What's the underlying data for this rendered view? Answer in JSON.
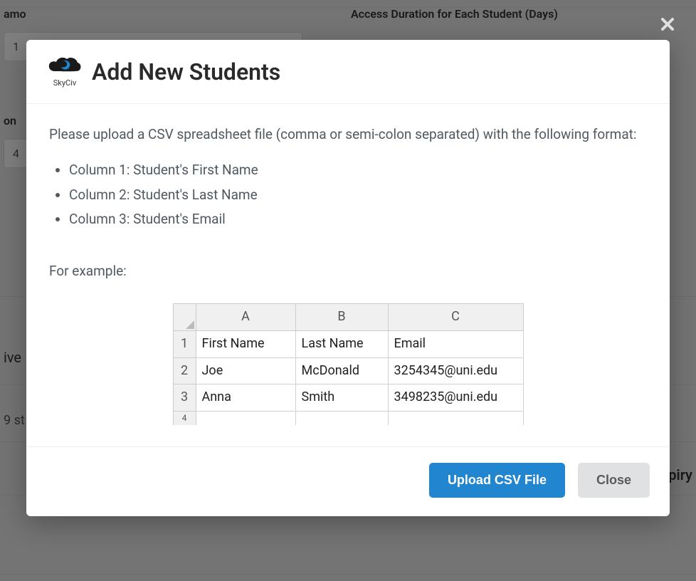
{
  "background": {
    "name_label_partial": "amo",
    "name_value_partial": " 1",
    "phone_label_partial": "on",
    "phone_value_partial": "4",
    "access_label": "Access Duration for Each Student (Days)",
    "section_partial": "ive",
    "count_partial": "9 st",
    "expiry_label": "xpiry"
  },
  "modal": {
    "logo_text": "SkyCiv",
    "title": "Add New Students",
    "instruction": "Please upload a CSV spreadsheet file (comma or semi-colon separated) with the following format:",
    "columns": [
      "Column 1: Student's First Name",
      "Column 2: Student's Last Name",
      "Column 3: Student's Email"
    ],
    "example_label": "For example:",
    "example_table": {
      "col_headers": [
        "A",
        "B",
        "C"
      ],
      "row_headers": [
        "1",
        "2",
        "3",
        "4"
      ],
      "rows": [
        [
          "First Name",
          "Last Name",
          "Email"
        ],
        [
          "Joe",
          "McDonald",
          "3254345@uni.edu"
        ],
        [
          "Anna",
          "Smith",
          "3498235@uni.edu"
        ]
      ]
    },
    "upload_button": "Upload CSV File",
    "close_button": "Close"
  }
}
